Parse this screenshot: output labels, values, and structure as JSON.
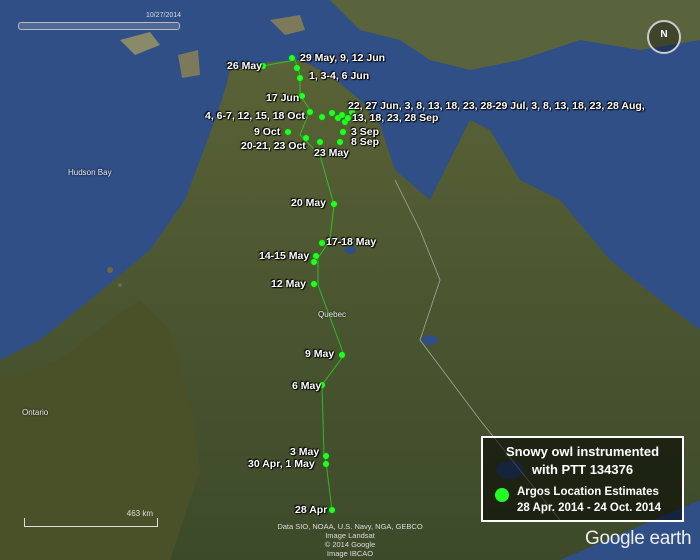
{
  "map": {
    "water_color": "#2f4f86",
    "land_color": "#4f5a30",
    "place_names": [
      {
        "text": "Hudson Bay"
      },
      {
        "text": "Quebec"
      },
      {
        "text": "Ontario"
      }
    ]
  },
  "track": {
    "point_color": "#22ff22",
    "labels": [
      {
        "text": "26 May"
      },
      {
        "text": "29 May,  9, 12 Jun"
      },
      {
        "text": "1, 3-4, 6 Jun"
      },
      {
        "text": "17 Jun"
      },
      {
        "text": "22, 27 Jun,  3, 8, 13, 18, 23, 28-29 Jul,  3, 8, 13, 18, 23, 28 Aug,"
      },
      {
        "text": "13, 18, 23, 28 Sep"
      },
      {
        "text": "4, 6-7, 12, 15, 18 Oct"
      },
      {
        "text": "9 Oct"
      },
      {
        "text": "3 Sep"
      },
      {
        "text": "8 Sep"
      },
      {
        "text": "20-21, 23 Oct"
      },
      {
        "text": "23 May"
      },
      {
        "text": "20 May"
      },
      {
        "text": "17-18 May"
      },
      {
        "text": "14-15 May"
      },
      {
        "text": "12 May"
      },
      {
        "text": "9 May"
      },
      {
        "text": "6 May"
      },
      {
        "text": "3 May"
      },
      {
        "text": "30 Apr,  1 May"
      },
      {
        "text": "28 Apr"
      }
    ]
  },
  "legend": {
    "title_line1": "Snowy owl instrumented",
    "title_line2": "with PTT 134376",
    "entry": "Argos Location Estimates",
    "date_range": "28 Apr. 2014 - 24 Oct. 2014"
  },
  "ui": {
    "time_slider_date": "10/27/2014",
    "scale_text": "463 km",
    "attribution": [
      "Data SIO, NOAA, U.S. Navy, NGA, GEBCO",
      "Image Landsat",
      "© 2014 Google",
      "Image IBCAO"
    ],
    "logo_text": "Google earth",
    "compass_letter": "N"
  }
}
